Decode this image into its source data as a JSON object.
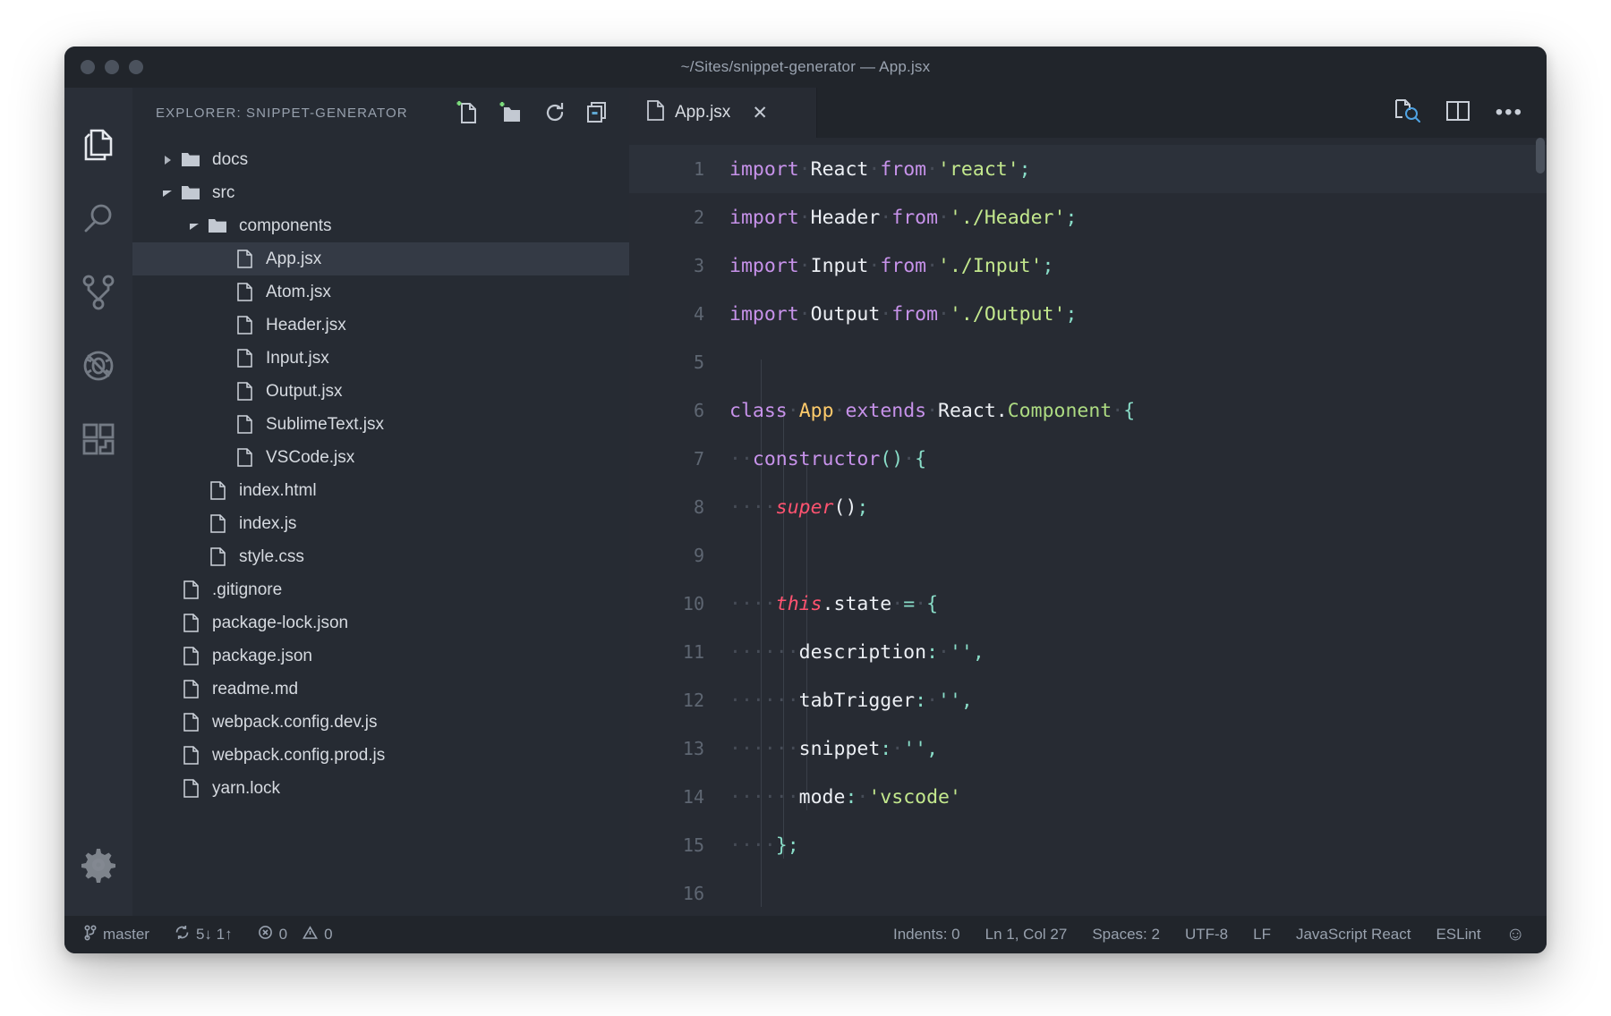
{
  "window": {
    "title": "~/Sites/snippet-generator — App.jsx",
    "traffic_lights": [
      "close",
      "minimize",
      "zoom"
    ]
  },
  "activity_bar": {
    "items": [
      {
        "name": "explorer",
        "icon": "files-icon",
        "active": true
      },
      {
        "name": "search",
        "icon": "search-icon",
        "active": false
      },
      {
        "name": "source-control",
        "icon": "source-control-icon",
        "active": false
      },
      {
        "name": "debug",
        "icon": "debug-icon",
        "active": false
      },
      {
        "name": "extensions",
        "icon": "extensions-icon",
        "active": false
      }
    ],
    "bottom": {
      "name": "manage",
      "icon": "gear-icon"
    }
  },
  "explorer": {
    "title": "EXPLORER: SNIPPET-GENERATOR",
    "actions": [
      {
        "name": "new-file",
        "icon": "new-file-icon"
      },
      {
        "name": "new-folder",
        "icon": "new-folder-icon"
      },
      {
        "name": "refresh",
        "icon": "refresh-icon"
      },
      {
        "name": "collapse-all",
        "icon": "collapse-all-icon"
      }
    ],
    "tree": [
      {
        "label": "docs",
        "type": "folder",
        "depth": 0,
        "expanded": false,
        "selected": false
      },
      {
        "label": "src",
        "type": "folder",
        "depth": 0,
        "expanded": true,
        "selected": false
      },
      {
        "label": "components",
        "type": "folder",
        "depth": 1,
        "expanded": true,
        "selected": false
      },
      {
        "label": "App.jsx",
        "type": "file",
        "depth": 2,
        "selected": true
      },
      {
        "label": "Atom.jsx",
        "type": "file",
        "depth": 2,
        "selected": false
      },
      {
        "label": "Header.jsx",
        "type": "file",
        "depth": 2,
        "selected": false
      },
      {
        "label": "Input.jsx",
        "type": "file",
        "depth": 2,
        "selected": false
      },
      {
        "label": "Output.jsx",
        "type": "file",
        "depth": 2,
        "selected": false
      },
      {
        "label": "SublimeText.jsx",
        "type": "file",
        "depth": 2,
        "selected": false
      },
      {
        "label": "VSCode.jsx",
        "type": "file",
        "depth": 2,
        "selected": false
      },
      {
        "label": "index.html",
        "type": "file",
        "depth": 1,
        "selected": false
      },
      {
        "label": "index.js",
        "type": "file",
        "depth": 1,
        "selected": false
      },
      {
        "label": "style.css",
        "type": "file",
        "depth": 1,
        "selected": false
      },
      {
        "label": ".gitignore",
        "type": "file",
        "depth": 0,
        "selected": false
      },
      {
        "label": "package-lock.json",
        "type": "file",
        "depth": 0,
        "selected": false
      },
      {
        "label": "package.json",
        "type": "file",
        "depth": 0,
        "selected": false
      },
      {
        "label": "readme.md",
        "type": "file",
        "depth": 0,
        "selected": false
      },
      {
        "label": "webpack.config.dev.js",
        "type": "file",
        "depth": 0,
        "selected": false
      },
      {
        "label": "webpack.config.prod.js",
        "type": "file",
        "depth": 0,
        "selected": false
      },
      {
        "label": "yarn.lock",
        "type": "file",
        "depth": 0,
        "selected": false
      }
    ]
  },
  "editor": {
    "tabs": [
      {
        "label": "App.jsx",
        "icon": "file-icon",
        "close_label": "✕",
        "active": true
      }
    ],
    "actions": [
      {
        "name": "open-preview",
        "icon": "open-preview-icon"
      },
      {
        "name": "split-editor",
        "icon": "split-editor-icon"
      },
      {
        "name": "more-actions",
        "icon": "more-actions-icon",
        "label": "•••"
      }
    ],
    "current_line": 1,
    "lines": [
      {
        "n": "1",
        "tokens": [
          {
            "t": "import",
            "c": "kw"
          },
          {
            "t": "·",
            "c": "ws"
          },
          {
            "t": "React",
            "c": "id"
          },
          {
            "t": "·",
            "c": "ws"
          },
          {
            "t": "from",
            "c": "kw"
          },
          {
            "t": "·",
            "c": "ws"
          },
          {
            "t": "'react'",
            "c": "str"
          },
          {
            "t": ";",
            "c": "punc"
          }
        ]
      },
      {
        "n": "2",
        "tokens": [
          {
            "t": "import",
            "c": "kw"
          },
          {
            "t": "·",
            "c": "ws"
          },
          {
            "t": "Header",
            "c": "id"
          },
          {
            "t": "·",
            "c": "ws"
          },
          {
            "t": "from",
            "c": "kw"
          },
          {
            "t": "·",
            "c": "ws"
          },
          {
            "t": "'./Header'",
            "c": "str"
          },
          {
            "t": ";",
            "c": "punc"
          }
        ]
      },
      {
        "n": "3",
        "tokens": [
          {
            "t": "import",
            "c": "kw"
          },
          {
            "t": "·",
            "c": "ws"
          },
          {
            "t": "Input",
            "c": "id"
          },
          {
            "t": "·",
            "c": "ws"
          },
          {
            "t": "from",
            "c": "kw"
          },
          {
            "t": "·",
            "c": "ws"
          },
          {
            "t": "'./Input'",
            "c": "str"
          },
          {
            "t": ";",
            "c": "punc"
          }
        ]
      },
      {
        "n": "4",
        "tokens": [
          {
            "t": "import",
            "c": "kw"
          },
          {
            "t": "·",
            "c": "ws"
          },
          {
            "t": "Output",
            "c": "id"
          },
          {
            "t": "·",
            "c": "ws"
          },
          {
            "t": "from",
            "c": "kw"
          },
          {
            "t": "·",
            "c": "ws"
          },
          {
            "t": "'./Output'",
            "c": "str"
          },
          {
            "t": ";",
            "c": "punc"
          }
        ]
      },
      {
        "n": "5",
        "tokens": []
      },
      {
        "n": "6",
        "tokens": [
          {
            "t": "class",
            "c": "kw"
          },
          {
            "t": "·",
            "c": "ws"
          },
          {
            "t": "App",
            "c": "cls"
          },
          {
            "t": "·",
            "c": "ws"
          },
          {
            "t": "extends",
            "c": "kw"
          },
          {
            "t": "·",
            "c": "ws"
          },
          {
            "t": "React",
            "c": "id"
          },
          {
            "t": ".",
            "c": "id"
          },
          {
            "t": "Component",
            "c": "grn"
          },
          {
            "t": "·",
            "c": "ws"
          },
          {
            "t": "{",
            "c": "punc"
          }
        ]
      },
      {
        "n": "7",
        "tokens": [
          {
            "t": "··",
            "c": "ws"
          },
          {
            "t": "constructor",
            "c": "fn"
          },
          {
            "t": "()",
            "c": "punc"
          },
          {
            "t": "·",
            "c": "ws"
          },
          {
            "t": "{",
            "c": "punc"
          }
        ]
      },
      {
        "n": "8",
        "tokens": [
          {
            "t": "····",
            "c": "ws"
          },
          {
            "t": "super",
            "c": "this"
          },
          {
            "t": "()",
            "c": "id"
          },
          {
            "t": ";",
            "c": "punc"
          }
        ]
      },
      {
        "n": "9",
        "tokens": []
      },
      {
        "n": "10",
        "tokens": [
          {
            "t": "····",
            "c": "ws"
          },
          {
            "t": "this",
            "c": "this"
          },
          {
            "t": ".",
            "c": "id"
          },
          {
            "t": "state",
            "c": "prop"
          },
          {
            "t": "·",
            "c": "ws"
          },
          {
            "t": "=",
            "c": "op"
          },
          {
            "t": "·",
            "c": "ws"
          },
          {
            "t": "{",
            "c": "punc"
          }
        ]
      },
      {
        "n": "11",
        "tokens": [
          {
            "t": "······",
            "c": "ws"
          },
          {
            "t": "description",
            "c": "prop"
          },
          {
            "t": ":",
            "c": "op"
          },
          {
            "t": "·",
            "c": "ws"
          },
          {
            "t": "''",
            "c": "str2"
          },
          {
            "t": ",",
            "c": "punc"
          }
        ]
      },
      {
        "n": "12",
        "tokens": [
          {
            "t": "······",
            "c": "ws"
          },
          {
            "t": "tabTrigger",
            "c": "prop"
          },
          {
            "t": ":",
            "c": "op"
          },
          {
            "t": "·",
            "c": "ws"
          },
          {
            "t": "''",
            "c": "str2"
          },
          {
            "t": ",",
            "c": "punc"
          }
        ]
      },
      {
        "n": "13",
        "tokens": [
          {
            "t": "······",
            "c": "ws"
          },
          {
            "t": "snippet",
            "c": "prop"
          },
          {
            "t": ":",
            "c": "op"
          },
          {
            "t": "·",
            "c": "ws"
          },
          {
            "t": "''",
            "c": "str2"
          },
          {
            "t": ",",
            "c": "punc"
          }
        ]
      },
      {
        "n": "14",
        "tokens": [
          {
            "t": "······",
            "c": "ws"
          },
          {
            "t": "mode",
            "c": "prop"
          },
          {
            "t": ":",
            "c": "op"
          },
          {
            "t": "·",
            "c": "ws"
          },
          {
            "t": "'vscode'",
            "c": "str"
          }
        ]
      },
      {
        "n": "15",
        "tokens": [
          {
            "t": "····",
            "c": "ws"
          },
          {
            "t": "};",
            "c": "punc"
          }
        ]
      },
      {
        "n": "16",
        "tokens": []
      }
    ]
  },
  "status_bar": {
    "left": [
      {
        "name": "branch",
        "icon": "git-branch-icon",
        "label": "master"
      },
      {
        "name": "sync",
        "icon": "sync-icon",
        "label": "5↓ 1↑"
      },
      {
        "name": "problems",
        "icon": "error-icon",
        "label": "0",
        "icon2": "warning-icon",
        "label2": "0"
      }
    ],
    "right": [
      {
        "name": "indents",
        "label": "Indents: 0"
      },
      {
        "name": "cursor",
        "label": "Ln 1, Col 27"
      },
      {
        "name": "spaces",
        "label": "Spaces: 2"
      },
      {
        "name": "encoding",
        "label": "UTF-8"
      },
      {
        "name": "eol",
        "label": "LF"
      },
      {
        "name": "language",
        "label": "JavaScript React"
      },
      {
        "name": "eslint",
        "label": "ESLint"
      },
      {
        "name": "feedback",
        "label": "☺"
      }
    ]
  },
  "colors": {
    "window_bg": "#272b33",
    "chrome_bg": "#21252b",
    "sidebar_bg": "#262b33",
    "activity_bg": "#2a2f38",
    "selection": "#343a45",
    "keyword": "#c792ea",
    "string": "#c3e88d",
    "class": "#ffcb6b",
    "this": "#ff5370",
    "punct": "#89ddc8",
    "accent_green": "#7ddc7d"
  }
}
